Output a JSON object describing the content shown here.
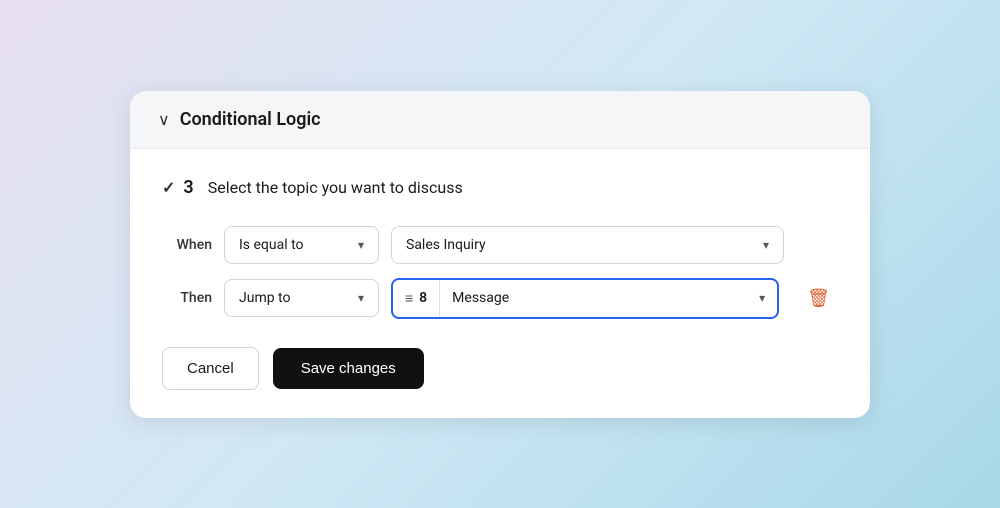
{
  "section": {
    "title": "Conditional Logic",
    "chevron": "❮"
  },
  "question": {
    "check_symbol": "✓",
    "number": "3",
    "text": "Select the topic you want to discuss"
  },
  "when_row": {
    "label": "When",
    "condition_value": "Is equal to",
    "condition_value_option": "Sales Inquiry"
  },
  "then_row": {
    "label": "Then",
    "action_value": "Jump to",
    "target_number": "8",
    "target_label": "Message"
  },
  "actions": {
    "cancel_label": "Cancel",
    "save_label": "Save changes"
  }
}
